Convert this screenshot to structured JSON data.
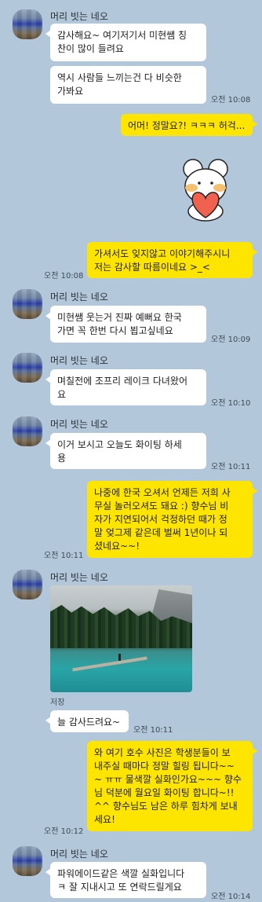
{
  "sender": "머리 빗는 네오",
  "m1": {
    "text1": "감사해요~ 여기저기서 미현쌤 칭\n찬이 많이 들려요",
    "text2": "역시 사람들 느끼는건 다 비슷한\n가봐요",
    "time": "오전 10:08"
  },
  "r1": {
    "text": "어머! 정말요?! ㅋㅋㅋ 허걱..."
  },
  "r2": {
    "text": "가셔서도 잊지않고 이야기해주시니\n저는 감사할 따름이네요 >_<",
    "time": "오전 10:08"
  },
  "m2": {
    "text": "미현쌤 웃는거 진짜 예뻐요 한국\n가면 꼭 한번 다시 뵙고싶네요",
    "time": "오전 10:09"
  },
  "m3": {
    "text": "며칠전에 조프리 레이크 다녀왔어\n요",
    "time": "오전 10:10"
  },
  "m4": {
    "text": "이거 보시고 오늘도 화이팅 하세\n용",
    "time": "오전 10:11"
  },
  "r3": {
    "text": "나중에 한국 오셔서 언제든 저희 사\n무실 놀러오셔도 돼요 :) 향수님 비\n자가 지연되어서 걱정하던 때가 정\n말 엊그제 같은데 벌써 1년이나 되\n셨네요~~!",
    "time": "오전 10:11"
  },
  "m5": {
    "save": "저장",
    "text": "늘 감사드려요~",
    "time": "오전 10:11"
  },
  "r4": {
    "text": "와 여기 호수 사진은 학생분들이 보\n내주실 때마다 정말 힐링 됩니다~~\n~ ㅠㅠ 물색깔 실화인가요~~~ 향수\n님 덕분에 월요일 화이팅 합니다~!!\n^^ 향수님도 남은 하루 힘차게 보내\n세요!",
    "time": "오전 10:12"
  },
  "m6": {
    "text": "파워에이드같은 색깔 실화입니다\nㅋ 잘 지내시고 또 연락드릴게요",
    "time": "오전 10:14"
  }
}
